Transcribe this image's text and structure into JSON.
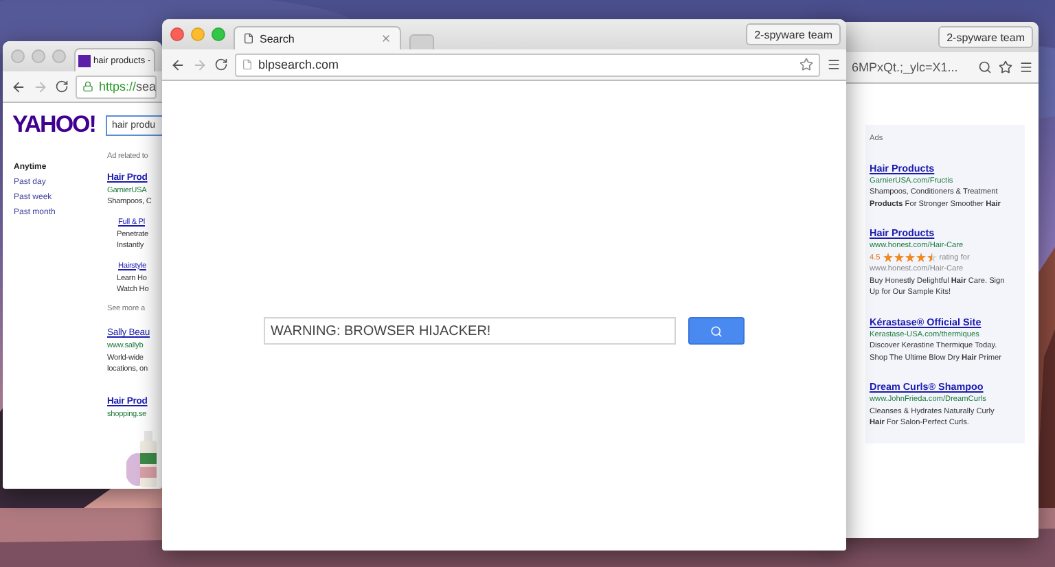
{
  "yahoo_window": {
    "tab_title": "hair products -",
    "secure_scheme": "https://",
    "address": "sea",
    "logo": "YAHOO!",
    "search_value": "hair produ",
    "filters": [
      {
        "label": "Anytime",
        "selected": true
      },
      {
        "label": "Past day",
        "selected": false
      },
      {
        "label": "Past week",
        "selected": false
      },
      {
        "label": "Past month",
        "selected": false
      }
    ],
    "ad_label": "Ad related to",
    "results": [
      {
        "kind": "ad",
        "title": "Hair Prod",
        "url": "GarnierUSA",
        "lines": [
          "Shampoos, C"
        ],
        "sitelinks": [
          {
            "title": "Full & Pl",
            "lines": [
              "Penetrate",
              "Instantly"
            ]
          },
          {
            "title": "Hairstyle",
            "lines": [
              "Learn Ho",
              "Watch Ho"
            ]
          }
        ]
      },
      {
        "kind": "more",
        "text": "See more a"
      },
      {
        "kind": "result",
        "title": "Sally Beau",
        "url": "www.sallyb",
        "lines": [
          "World-wide",
          "locations, on"
        ]
      },
      {
        "kind": "shopping",
        "title": "Hair Prod",
        "url": "shopping.se"
      }
    ]
  },
  "search_window": {
    "tab_title": "Search",
    "profile": "2-spyware team",
    "address": "blpsearch.com",
    "query": "WARNING: BROWSER HIJACKER!"
  },
  "ads_window": {
    "profile": "2-spyware team",
    "address": "6MPxQt.;_ylc=X1...",
    "ads_label": "Ads",
    "ads": [
      {
        "title": "Hair Products",
        "url": "GarnierUSA.com/Fructis",
        "lines": [
          "Shampoos, Conditioners & Treatment",
          "**Products** For Stronger Smoother **Hair**"
        ]
      },
      {
        "title": "Hair Products",
        "url": "www.honest.com/Hair-Care",
        "rating": "4.5",
        "stars": 4.5,
        "rating_text": "rating for",
        "source": "www.honest.com/Hair-Care",
        "lines": [
          "Buy Honestly Delightful **Hair** Care. Sign",
          "Up for Our Sample Kits!"
        ]
      },
      {
        "title": "Kérastase® Official Site",
        "url": "Kerastase-USA.com/thermiques",
        "lines": [
          "Discover Kerastine Thermique Today.",
          "Shop The Ultime Blow Dry **Hair** Primer"
        ]
      },
      {
        "title": "Dream Curls® Shampoo",
        "url": "www.JohnFrieda.com/DreamCurls",
        "lines": [
          "Cleanses & Hydrates Naturally Curly",
          "**Hair** For Salon-Perfect Curls."
        ]
      }
    ]
  }
}
